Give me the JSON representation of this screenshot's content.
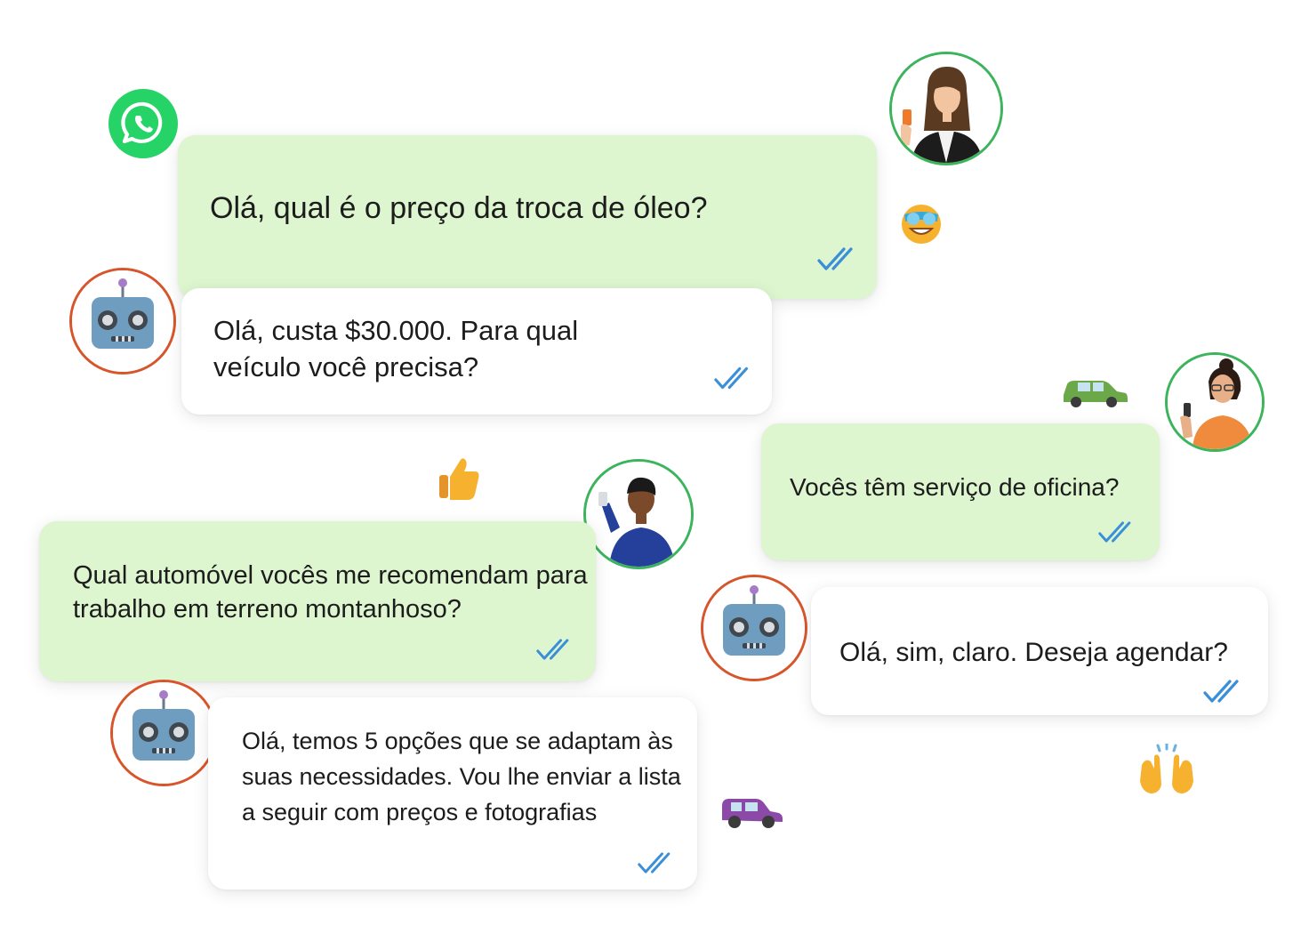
{
  "messages": [
    {
      "sender": "customer",
      "text": "Olá, qual é o preço da troca de óleo?",
      "status_icon": "double-check-read-icon"
    },
    {
      "sender": "bot",
      "text": "Olá, custa $30.000. Para qual veículo você precisa?",
      "status_icon": "double-check-read-icon"
    },
    {
      "sender": "customer",
      "text": "Vocês têm serviço de oficina?",
      "status_icon": "double-check-read-icon"
    },
    {
      "sender": "customer",
      "text": "Qual automóvel vocês me recomendam para trabalho em terreno montanhoso?",
      "status_icon": "double-check-read-icon"
    },
    {
      "sender": "bot",
      "text": "Olá, sim, claro. Deseja agendar?",
      "status_icon": "double-check-read-icon"
    },
    {
      "sender": "bot",
      "text": "Olá, temos 5 opções que se adaptam às suas necessidades. Vou lhe enviar a lista a seguir com preços e fotografias",
      "status_icon": "double-check-read-icon"
    }
  ],
  "icons": {
    "app_logo": "whatsapp-icon",
    "emojis": [
      "star-struck-emoji",
      "thumbs-up-emoji",
      "green-car-emoji",
      "raising-hands-emoji",
      "purple-suv-emoji"
    ]
  },
  "colors": {
    "customer_bubble": "#ddf6cf",
    "bot_bubble": "#ffffff",
    "customer_avatar_ring": "#3cb45c",
    "bot_avatar_ring": "#d8552b",
    "read_ticks": "#3a8fd8",
    "whatsapp_green": "#25d366"
  }
}
